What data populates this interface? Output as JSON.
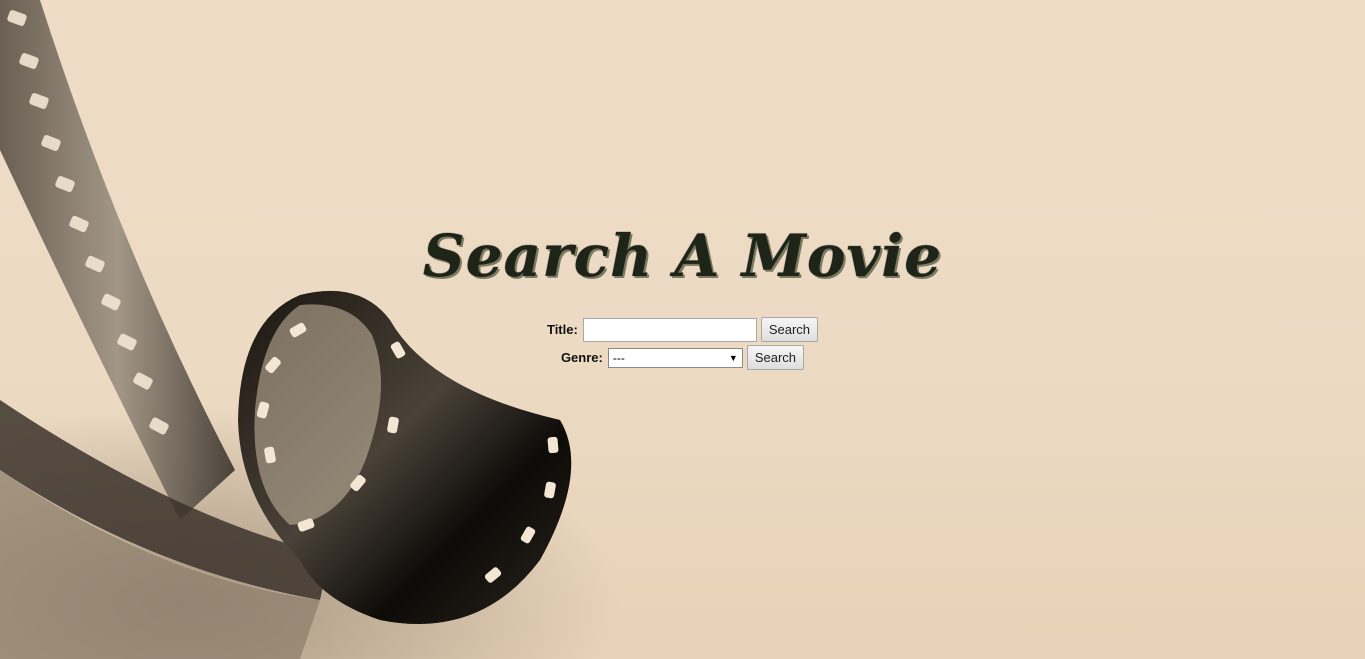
{
  "page": {
    "heading": "Search A Movie"
  },
  "title_search": {
    "label": "Title:",
    "value": "",
    "button_label": "Search"
  },
  "genre_search": {
    "label": "Genre:",
    "selected": "---",
    "button_label": "Search"
  },
  "background": {
    "image": "film-reel-sepia",
    "color": "#eddbc5"
  }
}
